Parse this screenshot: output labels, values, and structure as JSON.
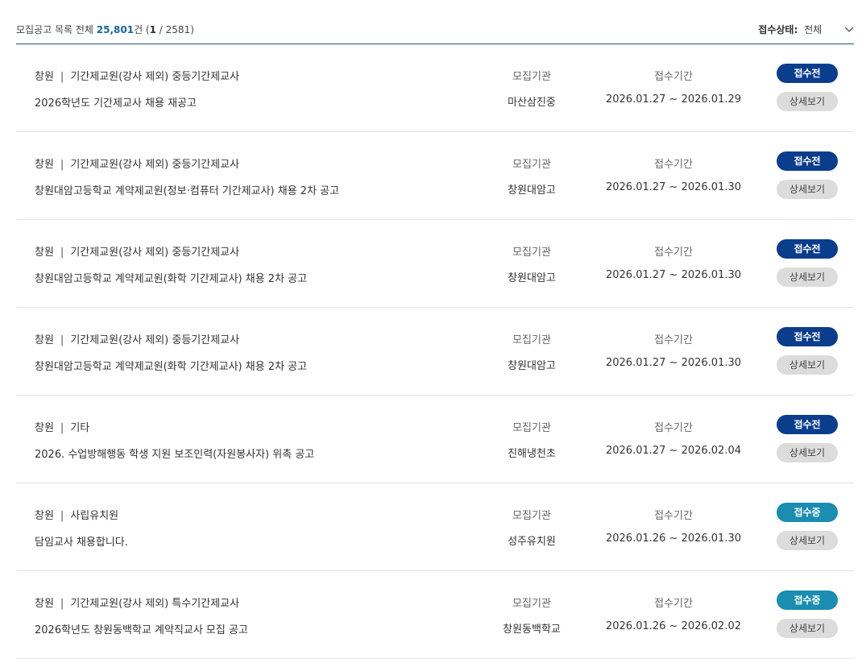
{
  "header": {
    "summary_prefix": "모집공고 목록 전체 ",
    "total_count": "25,801",
    "count_unit": "건 (",
    "current_page": "1",
    "page_sep": " / 2581)",
    "status_label": "접수상태:",
    "status_value": "전체"
  },
  "columns": {
    "org_header": "모집기관",
    "period_header": "접수기간",
    "detail_label": "상세보기",
    "category_sep": "|"
  },
  "colors": {
    "status_before": "#0a3d8c",
    "status_open": "#1a8db0"
  },
  "listings": [
    {
      "region": "창원",
      "category": "기간제교원(강사 제외) 중등기간제교사",
      "title": "2026학년도 기간제교사 채용 재공고",
      "org": "마산삼진중",
      "period": "2026.01.27 ~ 2026.01.29",
      "status": "접수전",
      "status_key": "before"
    },
    {
      "region": "창원",
      "category": "기간제교원(강사 제외) 중등기간제교사",
      "title": "창원대암고등학교 계약제교원(정보·컴퓨터 기간제교사) 채용 2차 공고",
      "org": "창원대암고",
      "period": "2026.01.27 ~ 2026.01.30",
      "status": "접수전",
      "status_key": "before"
    },
    {
      "region": "창원",
      "category": "기간제교원(강사 제외) 중등기간제교사",
      "title": "창원대암고등학교 계약제교원(화학 기간제교사) 채용 2차 공고",
      "org": "창원대암고",
      "period": "2026.01.27 ~ 2026.01.30",
      "status": "접수전",
      "status_key": "before"
    },
    {
      "region": "창원",
      "category": "기간제교원(강사 제외) 중등기간제교사",
      "title": "창원대암고등학교 계약제교원(화학 기간제교사) 채용 2차 공고",
      "org": "창원대암고",
      "period": "2026.01.27 ~ 2026.01.30",
      "status": "접수전",
      "status_key": "before"
    },
    {
      "region": "창원",
      "category": "기타",
      "title": "2026. 수업방해행동 학생 지원 보조인력(자원봉사자) 위촉 공고",
      "org": "진해냉천초",
      "period": "2026.01.27 ~ 2026.02.04",
      "status": "접수전",
      "status_key": "before"
    },
    {
      "region": "창원",
      "category": "사립유치원",
      "title": "담임교사 채용합니다.",
      "org": "성주유치원",
      "period": "2026.01.26 ~ 2026.01.30",
      "status": "접수중",
      "status_key": "open"
    },
    {
      "region": "창원",
      "category": "기간제교원(강사 제외) 특수기간제교사",
      "title": "2026학년도 창원동백학교 계약직교사 모집 공고",
      "org": "창원동백학교",
      "period": "2026.01.26 ~ 2026.02.02",
      "status": "접수중",
      "status_key": "open"
    }
  ]
}
